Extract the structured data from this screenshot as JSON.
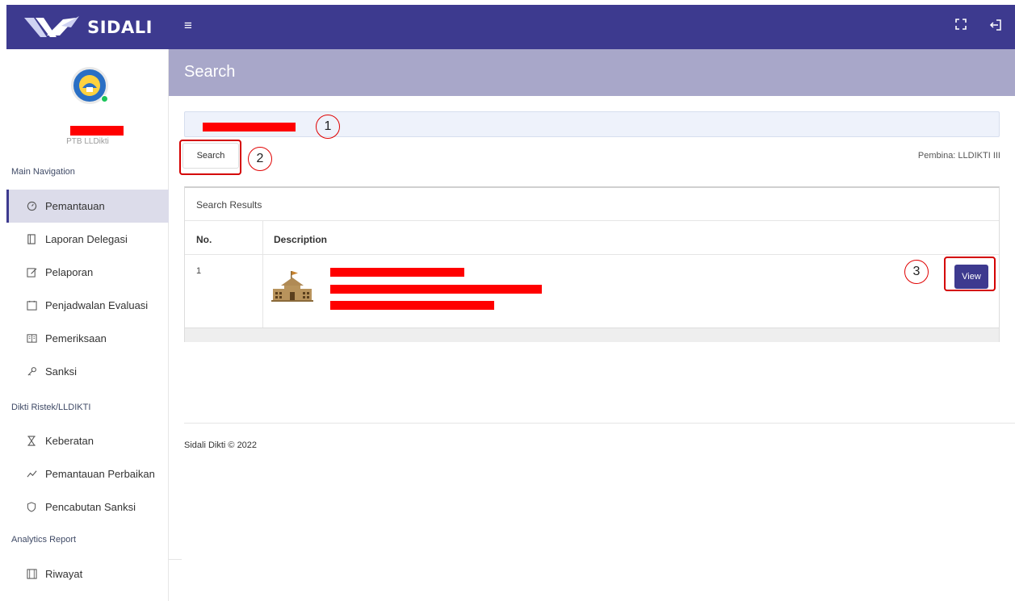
{
  "brand": {
    "name": "SIDALI"
  },
  "header": {
    "title": "Search"
  },
  "user": {
    "role": "PTB LLDikti"
  },
  "sidebar": {
    "sections": [
      {
        "header": "Main Navigation",
        "items": [
          {
            "label": "Pemantauan",
            "icon": "gauge-icon",
            "active": true
          },
          {
            "label": "Laporan Delegasi",
            "icon": "file-icon"
          },
          {
            "label": "Pelaporan",
            "icon": "edit-icon"
          },
          {
            "label": "Penjadwalan Evaluasi",
            "icon": "calendar-icon"
          },
          {
            "label": "Pemeriksaan",
            "icon": "book-icon"
          },
          {
            "label": "Sanksi",
            "icon": "key-icon"
          }
        ]
      },
      {
        "header": "Dikti Ristek/LLDIKTI",
        "items": [
          {
            "label": "Keberatan",
            "icon": "hourglass-icon"
          },
          {
            "label": "Pemantauan Perbaikan",
            "icon": "trend-icon"
          },
          {
            "label": "Pencabutan Sanksi",
            "icon": "shield-icon"
          }
        ]
      },
      {
        "header": "Analytics Report",
        "items": [
          {
            "label": "Riwayat",
            "icon": "history-icon"
          }
        ]
      }
    ]
  },
  "search": {
    "button_label": "Search",
    "pembina": "Pembina: LLDIKTI III"
  },
  "results": {
    "title": "Search Results",
    "columns": [
      "No.",
      "Description"
    ],
    "rows": [
      {
        "no": "1",
        "action_label": "View"
      }
    ]
  },
  "annotations": [
    "1",
    "2",
    "3"
  ],
  "footer": {
    "text": "Sidali Dikti © 2022"
  },
  "colors": {
    "primary": "#3d3a8f",
    "header_bg": "#a8a7c9",
    "redaction": "#ff0000",
    "annotation": "#e00000"
  }
}
